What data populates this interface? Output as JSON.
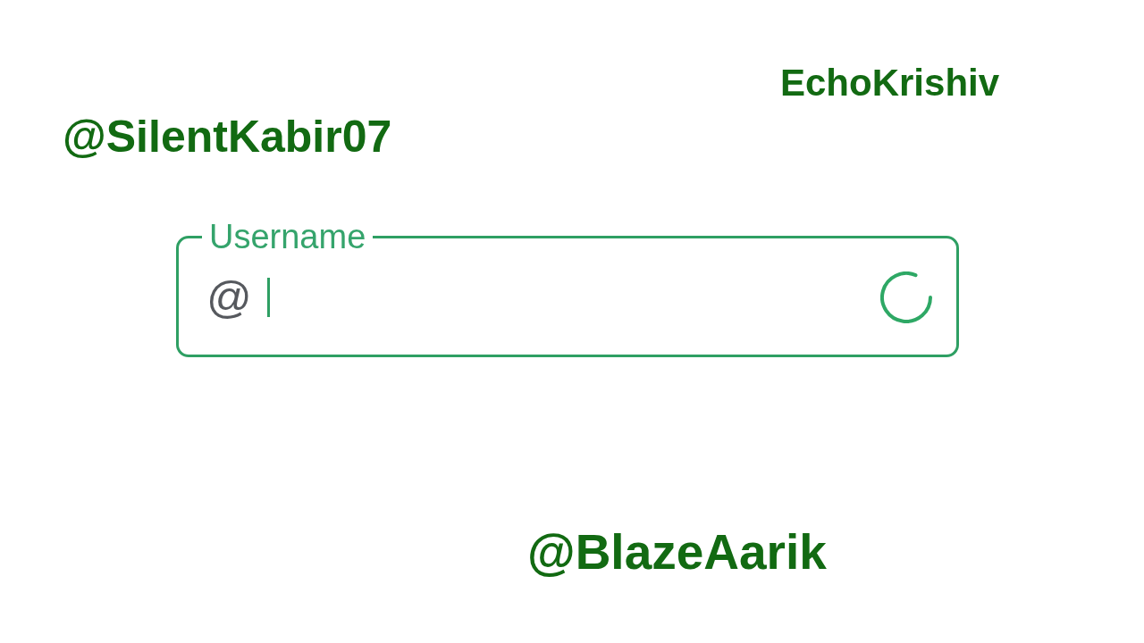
{
  "floating_names": [
    "EchoKrishiv",
    "@SilentKabir07",
    "@BlazeAarik"
  ],
  "username_field": {
    "label": "Username",
    "prefix": "@",
    "focused": true,
    "loading": true
  }
}
